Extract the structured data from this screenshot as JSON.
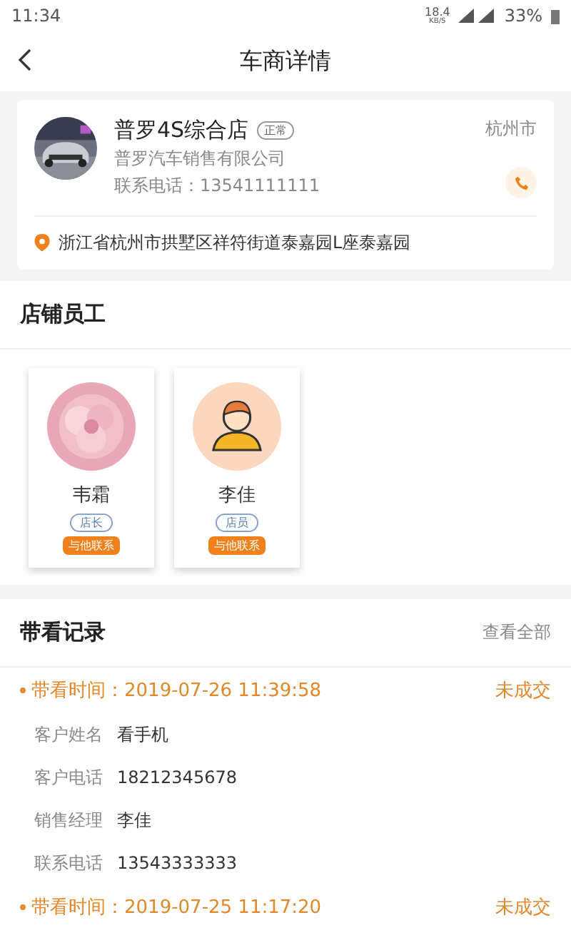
{
  "status_bar": {
    "time": "11:34",
    "speed": "18.4",
    "speed_unit": "KB/S",
    "battery": "33%"
  },
  "header": {
    "title": "车商详情"
  },
  "dealer": {
    "name": "普罗4S综合店",
    "badge": "正常",
    "company": "普罗汽车销售有限公司",
    "phone": "联系电话：13541111111",
    "city": "杭州市",
    "address": "浙江省杭州市拱墅区祥符街道泰嘉园L座泰嘉园"
  },
  "staff": {
    "title": "店铺员工",
    "members": [
      {
        "name": "韦霜",
        "role": "店长",
        "contact": "与他联系",
        "kind": "picture"
      },
      {
        "name": "李佳",
        "role": "店员",
        "contact": "与他联系",
        "kind": "figure"
      }
    ]
  },
  "records": {
    "title": "带看记录",
    "view_all": "查看全部",
    "items": [
      {
        "time_label": "带看时间：",
        "time": "2019-07-26 11:39:58",
        "status": "未成交",
        "fields": [
          {
            "label": "客户姓名",
            "value": "看手机"
          },
          {
            "label": "客户电话",
            "value": "18212345678"
          },
          {
            "label": "销售经理",
            "value": "李佳"
          },
          {
            "label": "联系电话",
            "value": "13543333333"
          }
        ]
      },
      {
        "time_label": "带看时间：",
        "time": "2019-07-25 11:17:20",
        "status": "未成交"
      }
    ]
  }
}
